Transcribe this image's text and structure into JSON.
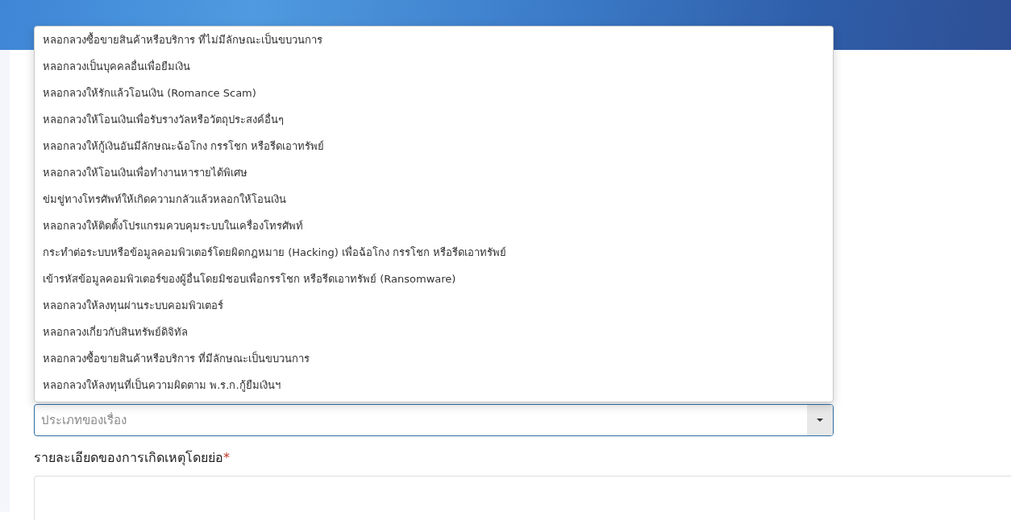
{
  "dropdown": {
    "options": [
      {
        "label": "หลอกลวงซื้อขายสินค้าหรือบริการ ที่ไม่มีลักษณะเป็นขบวนการ"
      },
      {
        "label": "หลอกลวงเป็นบุคคลอื่นเพื่อยืมเงิน"
      },
      {
        "label": "หลอกลวงให้รักแล้วโอนเงิน (Romance Scam)"
      },
      {
        "label": "หลอกลวงให้โอนเงินเพื่อรับรางวัลหรือวัตถุประสงค์อื่นๆ"
      },
      {
        "label": "หลอกลวงให้กู้เงินอันมีลักษณะฉ้อโกง กรรโชก หรือรีดเอาทรัพย์"
      },
      {
        "label": "หลอกลวงให้โอนเงินเพื่อทำงานหารายได้พิเศษ"
      },
      {
        "label": "ข่มขู่ทางโทรศัพท์ให้เกิดความกลัวแล้วหลอกให้โอนเงิน"
      },
      {
        "label": "หลอกลวงให้ติดตั้งโปรแกรมควบคุมระบบในเครื่องโทรศัพท์"
      },
      {
        "label": "กระทำต่อระบบหรือข้อมูลคอมพิวเตอร์โดยผิดกฎหมาย (Hacking) เพื่อฉ้อโกง กรรโชก หรือรีดเอาทรัพย์"
      },
      {
        "label": "เข้ารหัสข้อมูลคอมพิวเตอร์ของผู้อื่นโดยมิชอบเพื่อกรรโชก หรือรีดเอาทรัพย์ (Ransomware)"
      },
      {
        "label": "หลอกลวงให้ลงทุนผ่านระบบคอมพิวเตอร์"
      },
      {
        "label": "หลอกลวงเกี่ยวกับสินทรัพย์ดิจิทัล"
      },
      {
        "label": "หลอกลวงซื้อขายสินค้าหรือบริการ ที่มีลักษณะเป็นขบวนการ"
      },
      {
        "label": "หลอกลวงให้ลงทุนที่เป็นความผิดตาม พ.ร.ก.กู้ยืมเงินฯ"
      }
    ],
    "placeholder": "ประเภทของเรื่อง",
    "expanded": true
  },
  "details": {
    "label": "รายละเอียดของการเกิดเหตุโดยย่อ",
    "required_mark": "*"
  }
}
